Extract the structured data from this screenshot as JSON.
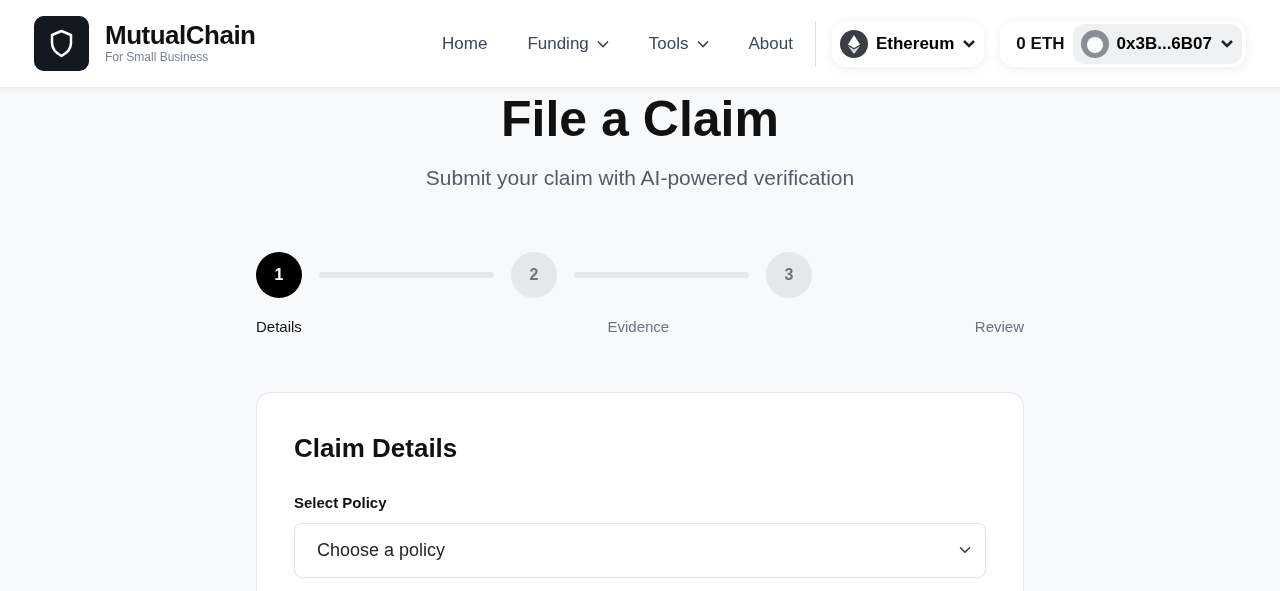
{
  "brand": {
    "name": "MutualChain",
    "tagline": "For Small Business"
  },
  "nav": [
    {
      "label": "Home",
      "has_menu": false
    },
    {
      "label": "Funding",
      "has_menu": true
    },
    {
      "label": "Tools",
      "has_menu": true
    },
    {
      "label": "About",
      "has_menu": false
    }
  ],
  "network": {
    "label": "Ethereum"
  },
  "wallet": {
    "balance": "0 ETH",
    "address": "0x3B...6B07"
  },
  "page": {
    "title": "File a Claim",
    "subtitle": "Submit your claim with AI-powered verification"
  },
  "steps": [
    {
      "number": "1",
      "label": "Details",
      "selected": true
    },
    {
      "number": "2",
      "label": "Evidence",
      "selected": false
    },
    {
      "number": "3",
      "label": "Review",
      "selected": false
    }
  ],
  "card": {
    "title": "Claim Details",
    "fields": [
      {
        "label": "Select Policy",
        "placeholder": "Choose a policy"
      }
    ]
  }
}
